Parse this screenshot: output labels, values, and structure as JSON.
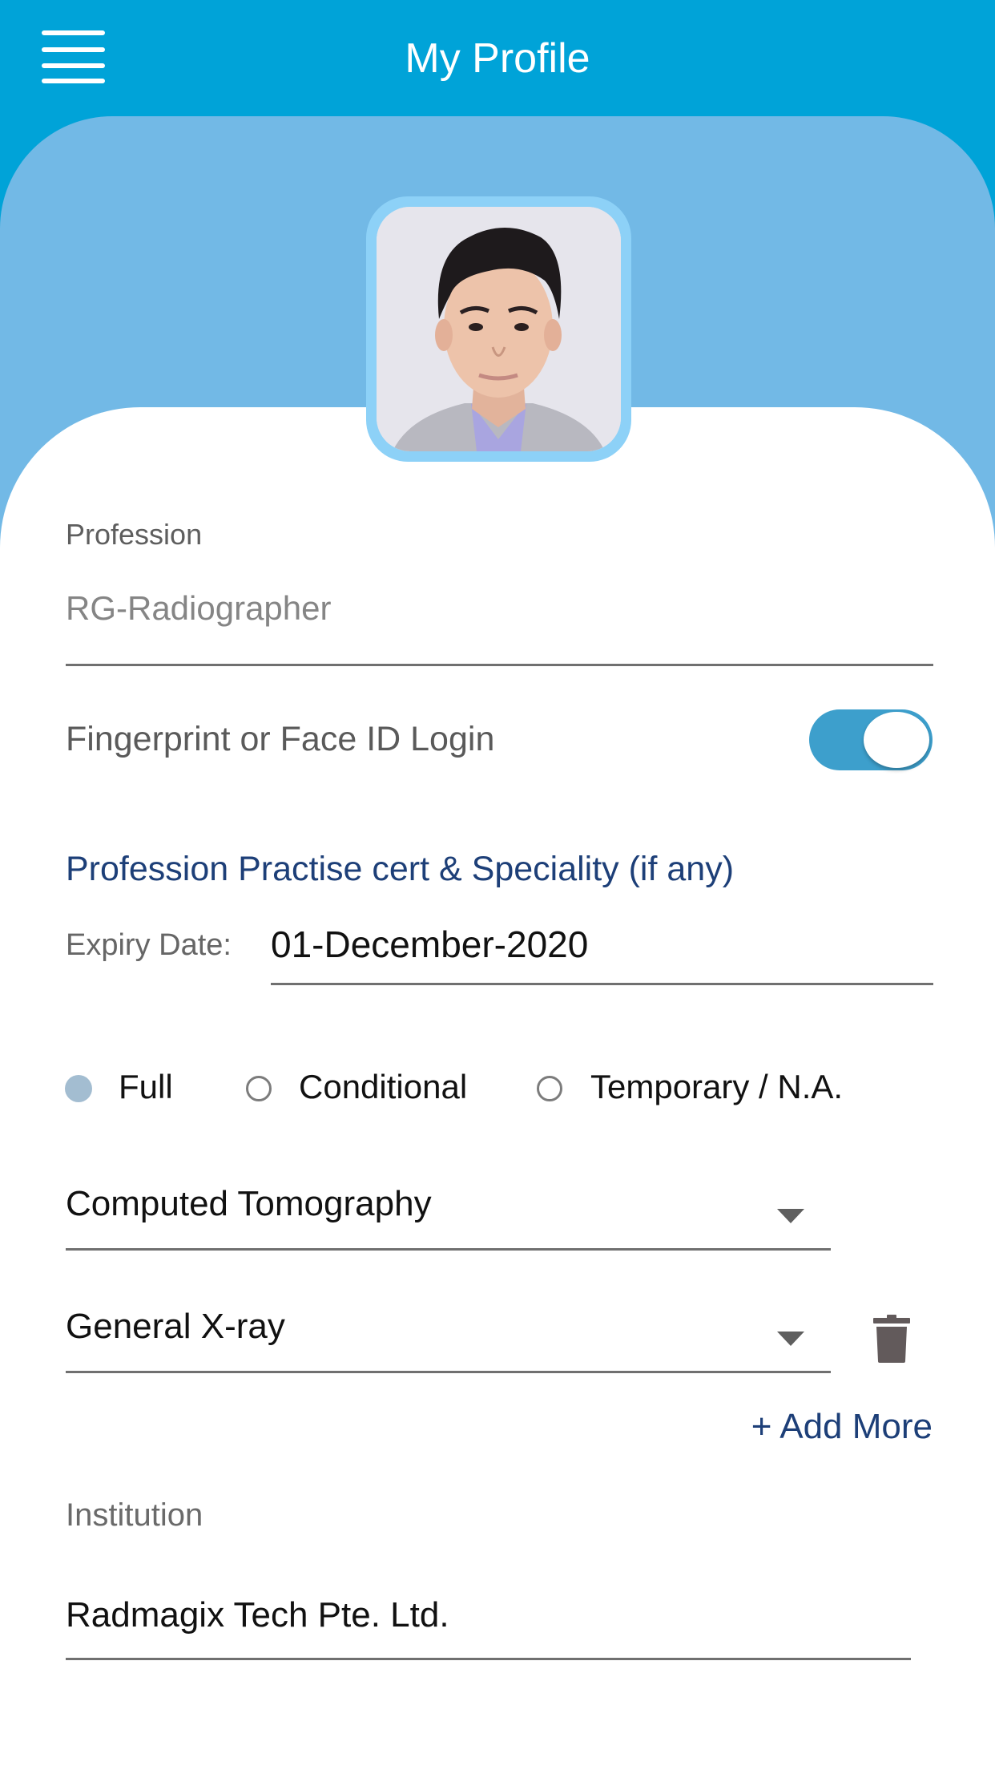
{
  "header": {
    "title": "My Profile",
    "menu_icon": "hamburger-menu-icon"
  },
  "profile": {
    "avatar_alt": "Profile photo",
    "profession": {
      "label": "Profession",
      "value": "RG-Radiographer"
    },
    "biometric_login": {
      "label": "Fingerprint or Face ID Login",
      "enabled": true
    },
    "certification": {
      "heading": "Profession Practise cert & Speciality (if any)",
      "expiry_label": "Expiry Date:",
      "expiry_value": "01-December-2020",
      "registration_types": [
        {
          "label": "Full",
          "selected": true
        },
        {
          "label": "Conditional",
          "selected": false
        },
        {
          "label": "Temporary / N.A.",
          "selected": false
        }
      ],
      "specialities": [
        {
          "value": "Computed Tomography",
          "deletable": false
        },
        {
          "value": "General X-ray",
          "deletable": true
        }
      ],
      "add_more_label": "+ Add More",
      "trash_icon": "trash-icon"
    },
    "institution": {
      "label": "Institution",
      "value": "Radmagix Tech Pte. Ltd."
    }
  },
  "colors": {
    "header_blue": "#00A3D8",
    "panel_blue": "#72B9E6",
    "avatar_frame": "#8DD1F7",
    "toggle_on": "#3D9FCC",
    "heading_navy": "#1D3F78",
    "radio_selected": "#A3BDD1"
  }
}
